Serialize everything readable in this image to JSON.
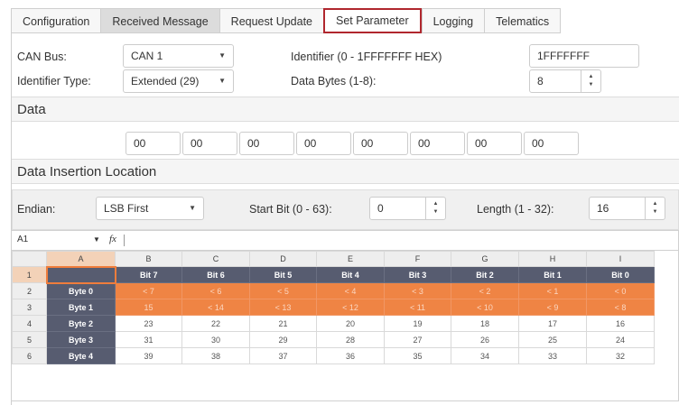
{
  "tabs": [
    {
      "label": "Configuration",
      "state": "normal"
    },
    {
      "label": "Received Message",
      "state": "grey"
    },
    {
      "label": "Request Update",
      "state": "normal"
    },
    {
      "label": "Set Parameter",
      "state": "active"
    },
    {
      "label": "Logging",
      "state": "normal"
    },
    {
      "label": "Telematics",
      "state": "normal"
    }
  ],
  "form": {
    "can_bus_label": "CAN Bus:",
    "can_bus_value": "CAN 1",
    "identifier_label": "Identifier (0 - 1FFFFFFF HEX)",
    "identifier_value": "1FFFFFFF",
    "identifier_type_label": "Identifier Type:",
    "identifier_type_value": "Extended (29)",
    "data_bytes_label": "Data Bytes (1-8):",
    "data_bytes_value": "8"
  },
  "data_section": {
    "title": "Data",
    "bytes": [
      "00",
      "00",
      "00",
      "00",
      "00",
      "00",
      "00",
      "00"
    ]
  },
  "insertion": {
    "title": "Data Insertion Location",
    "endian_label": "Endian:",
    "endian_value": "LSB First",
    "start_bit_label": "Start Bit (0 - 63):",
    "start_bit_value": "0",
    "length_label": "Length (1 - 32):",
    "length_value": "16"
  },
  "sheet": {
    "cell_ref": "A1",
    "fx": "fx",
    "columns": [
      "A",
      "B",
      "C",
      "D",
      "E",
      "F",
      "G",
      "H",
      "I"
    ],
    "rows": [
      {
        "num": "1",
        "cells": [
          "",
          "Bit 7",
          "Bit 6",
          "Bit 5",
          "Bit 4",
          "Bit 3",
          "Bit 2",
          "Bit 1",
          "Bit 0"
        ]
      },
      {
        "num": "2",
        "cells": [
          "Byte 0",
          "< 7",
          "< 6",
          "< 5",
          "< 4",
          "< 3",
          "< 2",
          "< 1",
          "< 0"
        ]
      },
      {
        "num": "3",
        "cells": [
          "Byte 1",
          "15",
          "< 14",
          "< 13",
          "< 12",
          "< 11",
          "< 10",
          "< 9",
          "< 8"
        ]
      },
      {
        "num": "4",
        "cells": [
          "Byte 2",
          "23",
          "22",
          "21",
          "20",
          "19",
          "18",
          "17",
          "16"
        ]
      },
      {
        "num": "5",
        "cells": [
          "Byte 3",
          "31",
          "30",
          "29",
          "28",
          "27",
          "26",
          "25",
          "24"
        ]
      },
      {
        "num": "6",
        "cells": [
          "Byte 4",
          "39",
          "38",
          "37",
          "36",
          "35",
          "34",
          "33",
          "32"
        ]
      }
    ]
  },
  "colors": {
    "active_tab_border": "#b0272e",
    "highlight": "#ef8444",
    "header_cell": "#575c70"
  }
}
